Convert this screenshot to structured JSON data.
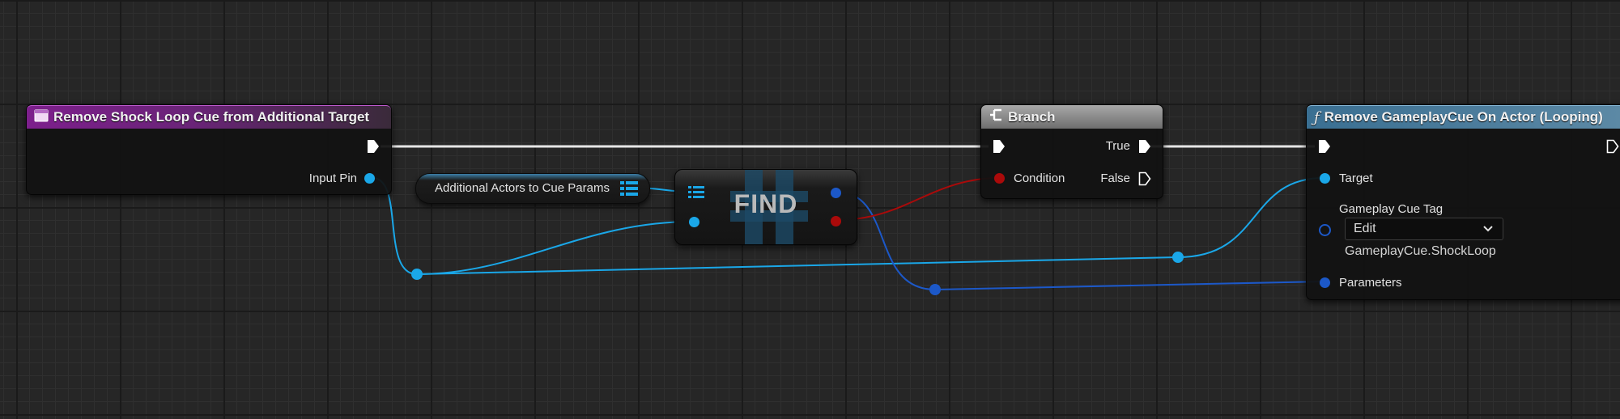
{
  "event_node": {
    "title": "Remove Shock Loop Cue from Additional Target",
    "input_pin_label": "Input Pin",
    "accent_color": "#7d1f8c"
  },
  "variable_node": {
    "label": "Additional Actors to Cue Params"
  },
  "find_node": {
    "label": "FIND"
  },
  "branch_node": {
    "title": "Branch",
    "condition_label": "Condition",
    "true_label": "True",
    "false_label": "False"
  },
  "function_node": {
    "title": "Remove GameplayCue On Actor (Looping)",
    "target_label": "Target",
    "tag_label": "Gameplay Cue Tag",
    "tag_dropdown_value": "Edit",
    "tag_value": "GameplayCue.ShockLoop",
    "parameters_label": "Parameters",
    "accent_color": "#3a6f92"
  },
  "colors": {
    "object_pin": "#1aa7e8",
    "struct_pin": "#1c58c8",
    "bool_pin": "#aa0a0a",
    "exec_wire": "#e6e6e6"
  },
  "icons": [
    "event-function-icon",
    "branch-icon",
    "function-f-icon",
    "array-icon",
    "chevron-down-icon"
  ]
}
